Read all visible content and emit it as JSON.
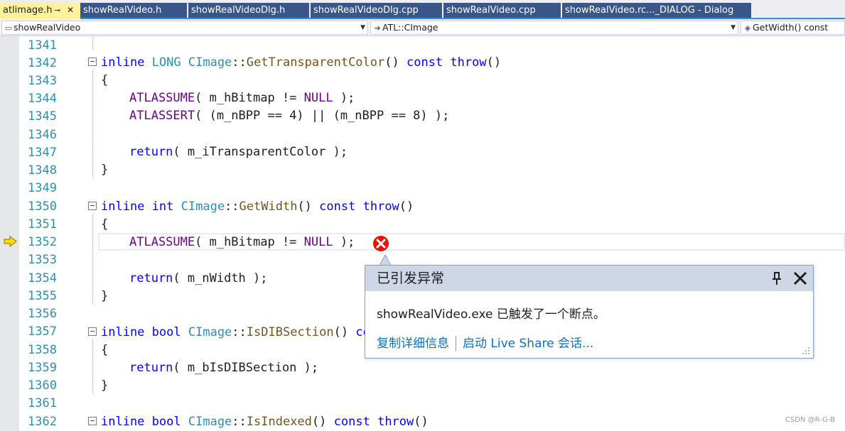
{
  "tabs": [
    {
      "label": "atlimage.h",
      "pin": "⊸",
      "close": "✕",
      "active": true
    },
    {
      "label": "showRealVideo.h"
    },
    {
      "label": "showRealVideoDlg.h"
    },
    {
      "label": "showRealVideoDlg.cpp"
    },
    {
      "label": "showRealVideo.cpp"
    },
    {
      "label": "showRealVideo.rc..._DIALOG - Dialog"
    }
  ],
  "navbar": {
    "project": "showRealVideo",
    "scope": "ATL::CImage",
    "member": "GetWidth() const"
  },
  "editor": {
    "line_numbers": [
      "1341",
      "1342",
      "1343",
      "1344",
      "1345",
      "1346",
      "1347",
      "1348",
      "1349",
      "1350",
      "1351",
      "1352",
      "1353",
      "1354",
      "1355",
      "1356",
      "1357",
      "1358",
      "1359",
      "1360",
      "1361",
      "1362"
    ],
    "current_line": "1352",
    "code": {
      "l1342": {
        "a": "inline",
        "b": "LONG",
        "c": "CImage",
        "d": "::",
        "e": "GetTransparentColor",
        "f": "()",
        "g": "const",
        "h": "throw",
        "i": "()"
      },
      "l1343": "{",
      "l1344": {
        "mac": "ATLASSUME",
        "rest1": "( m_hBitmap != ",
        "null": "NULL",
        "rest2": " );"
      },
      "l1345": {
        "mac": "ATLASSERT",
        "rest1": "( (m_nBPP == 4) || (m_nBPP == 8) );"
      },
      "l1347": {
        "kw": "return",
        "rest": "( m_iTransparentColor );"
      },
      "l1348": "}",
      "l1350": {
        "a": "inline",
        "b": "int",
        "c": "CImage",
        "d": "::",
        "e": "GetWidth",
        "f": "()",
        "g": "const",
        "h": "throw",
        "i": "()"
      },
      "l1351": "{",
      "l1352": {
        "mac": "ATLASSUME",
        "rest1": "( m_hBitmap != ",
        "null": "NULL",
        "rest2": " );"
      },
      "l1354": {
        "kw": "return",
        "rest": "( m_nWidth );"
      },
      "l1355": "}",
      "l1357": {
        "a": "inline",
        "b": "bool",
        "c": "CImage",
        "d": "::",
        "e": "IsDIBSection",
        "f": "()",
        "g": "co"
      },
      "l1358": "{",
      "l1359": {
        "kw": "return",
        "rest": "( m_bIsDIBSection );"
      },
      "l1360": "}",
      "l1362": {
        "a": "inline",
        "b": "bool",
        "c": "CImage",
        "d": "::",
        "e": "IsIndexed",
        "f": "()",
        "g": "const",
        "h": "throw",
        "i": "()"
      }
    }
  },
  "exception_popup": {
    "title": "已引发异常",
    "message": "showRealVideo.exe 已触发了一个断点。",
    "copy_details": "复制详细信息",
    "live_share": "启动 Live Share 会话..."
  },
  "watermark": "CSDN @R-G-B",
  "colors": {
    "active_tab": "#fff29d",
    "inactive_tab": "#3a5688",
    "keyword": "#0000ff",
    "type": "#2b91af",
    "macro": "#6f008a",
    "function": "#74531f",
    "link": "#0e70c0",
    "error": "#e51400"
  },
  "icons": {
    "exec_arrow": "execution-arrow-icon",
    "error": "error-x-icon",
    "pin": "pin-icon",
    "close": "close-icon"
  }
}
